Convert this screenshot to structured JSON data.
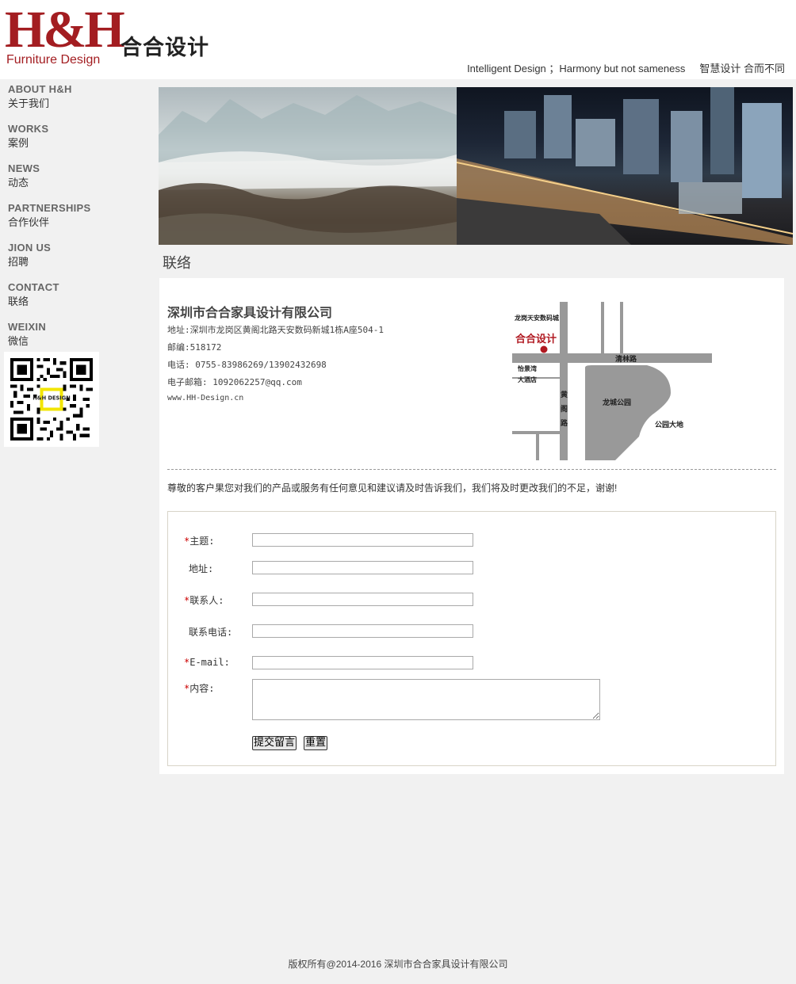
{
  "header": {
    "logo_text": "H&H",
    "logo_subtitle": "Furniture Design",
    "brand_cn": "合合设计",
    "slogan_en": "Intelligent Design ；Harmony but not sameness",
    "slogan_cn": "智慧设计 合而不同"
  },
  "sidebar": {
    "items": [
      {
        "en": "ABOUT H&H",
        "cn": "关于我们"
      },
      {
        "en": "WORKS",
        "cn": "案例"
      },
      {
        "en": "NEWS",
        "cn": "动态"
      },
      {
        "en": "PARTNERSHIPS",
        "cn": "合作伙伴"
      },
      {
        "en": "JION US",
        "cn": "招聘"
      },
      {
        "en": "CONTACT",
        "cn": "联络"
      },
      {
        "en": "WEIXIN",
        "cn": "微信"
      }
    ],
    "qr_logo_text": "H&H DESIGN"
  },
  "main": {
    "page_title": "联络",
    "company": {
      "name": "深圳市合合家具设计有限公司",
      "address": "地址:深圳市龙岗区黄阁北路天安数码新城1栋A座504-1",
      "postcode": "邮编:518172",
      "phone": "电话: 0755-83986269/13902432698",
      "email": "电子邮箱: 1092062257@qq.com",
      "website": "www.HH-Design.cn"
    },
    "map": {
      "label_building": "龙岗天安数码城",
      "label_company": "合合设计",
      "label_road1": "清林路",
      "label_hotel1": "怡景湾",
      "label_hotel2": "大酒店",
      "label_road2_a": "黄",
      "label_road2_b": "阁",
      "label_road2_c": "路",
      "label_park": "龙城公园",
      "label_land": "公园大地"
    },
    "notice": "尊敬的客户果您对我们的产品或服务有任何意见和建议请及时告诉我们，我们将及时更改我们的不足，谢谢!",
    "form": {
      "required_mark": "*",
      "subject_label": "主题:",
      "address_label": "地址:",
      "contact_label": "联系人:",
      "phone_label": "联系电话:",
      "email_label": "E-mail:",
      "content_label": "内容:",
      "subject_value": "",
      "address_value": "",
      "contact_value": "",
      "phone_value": "",
      "email_value": "",
      "content_value": "",
      "submit_label": "提交留言",
      "reset_label": "重置"
    }
  },
  "footer": {
    "copyright": "版权所有@2014-2016 深圳市合合家具设计有限公司"
  },
  "colors": {
    "brand_red": "#a31d21",
    "page_bg": "#f1f1f1",
    "required": "#cc0000"
  }
}
